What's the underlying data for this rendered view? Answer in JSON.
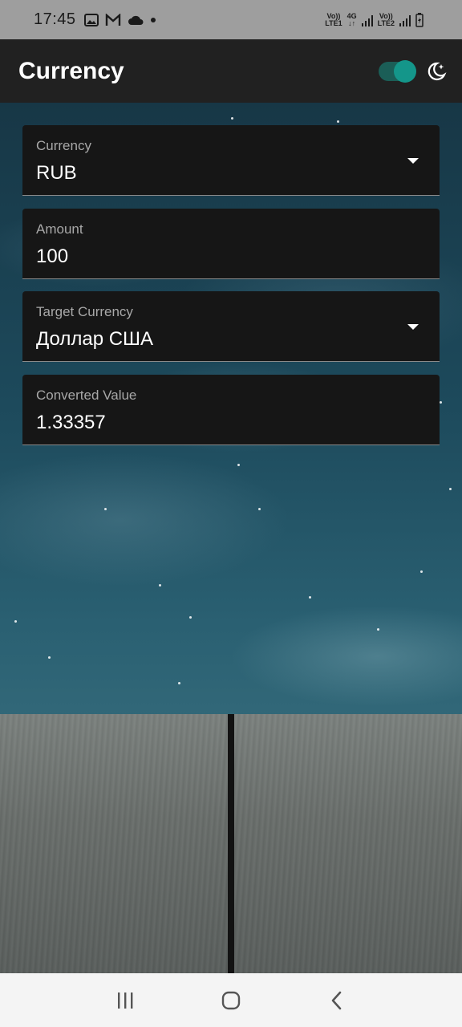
{
  "status_bar": {
    "time": "17:45",
    "icons": [
      "gallery-icon",
      "gmail-icon",
      "cloud-icon",
      "dot-icon"
    ],
    "network1": {
      "top": "Vo))",
      "bottom": "LTE1"
    },
    "network_type": "4G",
    "network2": {
      "top": "Vo))",
      "bottom": "LTE2"
    }
  },
  "app_bar": {
    "title": "Currency",
    "theme_toggle_on": true
  },
  "form": {
    "currency": {
      "label": "Currency",
      "value": "RUB"
    },
    "amount": {
      "label": "Amount",
      "value": "100"
    },
    "target_currency": {
      "label": "Target Currency",
      "value": "Доллар США"
    },
    "converted": {
      "label": "Converted Value",
      "value": "1.33357"
    }
  },
  "nav_bar": {
    "buttons": [
      "recents-icon",
      "home-icon",
      "back-icon"
    ]
  },
  "colors": {
    "app_bar": "#212121",
    "accent": "#14968a",
    "field_bg": "#161616"
  }
}
